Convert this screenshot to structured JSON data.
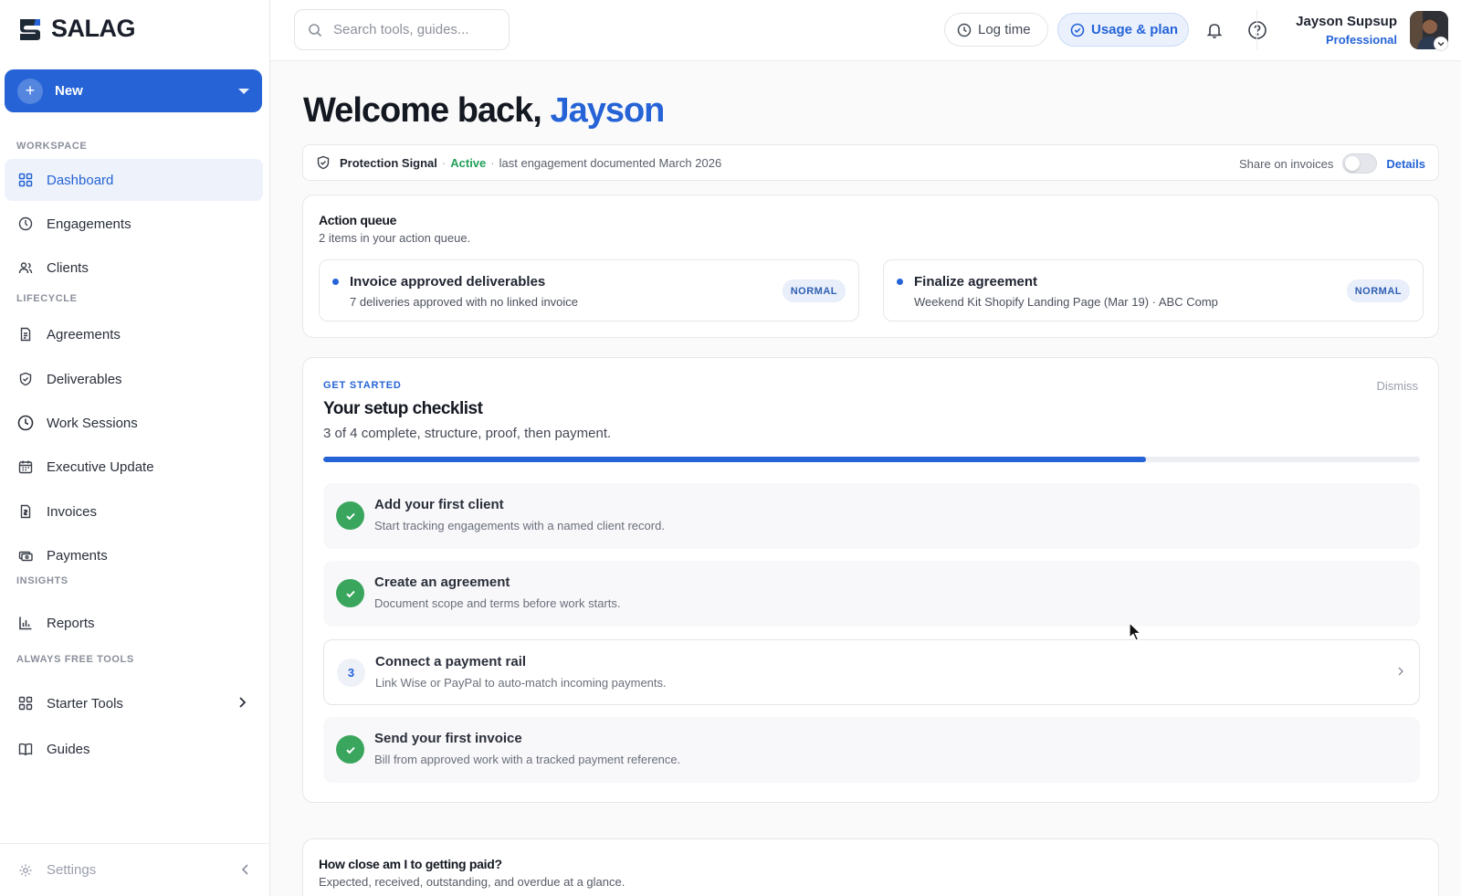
{
  "brand": {
    "name": "SALAG"
  },
  "sidebar": {
    "new_button": "New",
    "sections": {
      "workspace": "WORKSPACE",
      "lifecycle": "LIFECYCLE",
      "insights": "INSIGHTS",
      "free_tools": "ALWAYS FREE TOOLS"
    },
    "items": {
      "dashboard": "Dashboard",
      "engagements": "Engagements",
      "clients": "Clients",
      "agreements": "Agreements",
      "deliverables": "Deliverables",
      "work_sessions": "Work Sessions",
      "executive_update": "Executive Update",
      "invoices": "Invoices",
      "payments": "Payments",
      "reports": "Reports",
      "starter_tools": "Starter Tools",
      "guides": "Guides"
    },
    "active_item": "dashboard",
    "settings": "Settings"
  },
  "header": {
    "search_placeholder": "Search tools, guides...",
    "log_time": "Log time",
    "usage_plan": "Usage & plan",
    "user": {
      "name": "Jayson Supsup",
      "plan": "Professional"
    }
  },
  "welcome": {
    "prefix": "Welcome back,",
    "name": "Jayson"
  },
  "protection_signal": {
    "label": "Protection Signal",
    "separator": "·",
    "status": "Active",
    "detail": "last engagement documented March 2026",
    "share_label": "Share on invoices",
    "share_enabled": false,
    "details_link": "Details"
  },
  "action_queue": {
    "title": "Action queue",
    "subtitle": "2 items in your action queue.",
    "items": [
      {
        "title": "Invoice approved deliverables",
        "subtitle": "7 deliveries approved with no linked invoice",
        "badge": "NORMAL"
      },
      {
        "title": "Finalize agreement",
        "subtitle": "Weekend Kit Shopify Landing Page (Mar 19) · ABC Comp",
        "badge": "NORMAL"
      }
    ]
  },
  "checklist": {
    "eyebrow": "GET STARTED",
    "title": "Your setup checklist",
    "subtitle": "3 of 4 complete, structure, proof, then payment.",
    "dismiss": "Dismiss",
    "progress": 0.75,
    "steps": [
      {
        "title": "Add your first client",
        "subtitle": "Start tracking engagements with a named client record.",
        "done": true
      },
      {
        "title": "Create an agreement",
        "subtitle": "Document scope and terms before work starts.",
        "done": true
      },
      {
        "number": "3",
        "title": "Connect a payment rail",
        "subtitle": "Link Wise or PayPal to auto-match incoming payments.",
        "done": false
      },
      {
        "title": "Send your first invoice",
        "subtitle": "Bill from approved work with a tracked payment reference.",
        "done": true
      }
    ]
  },
  "payment_card": {
    "title": "How close am I to getting paid?",
    "subtitle": "Expected, received, outstanding, and overdue at a glance."
  },
  "colors": {
    "accent": "#2563d6",
    "success": "#3aa65d",
    "active_text": "#22a05a"
  }
}
